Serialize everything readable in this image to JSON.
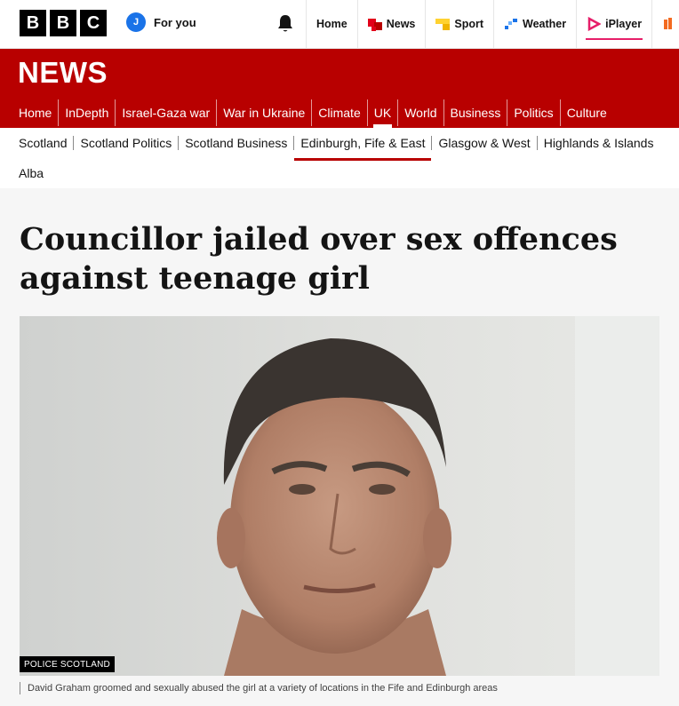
{
  "brand": {
    "logo_letters": [
      "B",
      "B",
      "C"
    ]
  },
  "account": {
    "initial": "J",
    "label": "For you"
  },
  "top_nav": [
    {
      "label": "Home",
      "icon": "none"
    },
    {
      "label": "News",
      "icon": "news-icon",
      "color": "#e2001a"
    },
    {
      "label": "Sport",
      "icon": "sport-icon",
      "color": "#ffd230"
    },
    {
      "label": "Weather",
      "icon": "weather-icon",
      "color": "#1a73e8"
    },
    {
      "label": "iPlayer",
      "icon": "iplayer-icon",
      "color": "#e61e69"
    }
  ],
  "section": {
    "title": "NEWS"
  },
  "main_nav": [
    "Home",
    "InDepth",
    "Israel-Gaza war",
    "War in Ukraine",
    "Climate",
    "UK",
    "World",
    "Business",
    "Politics",
    "Culture"
  ],
  "sub_nav_row1": [
    "Scotland",
    "Scotland Politics",
    "Scotland Business",
    "Edinburgh, Fife & East",
    "Glasgow & West",
    "Highlands & Islands"
  ],
  "sub_nav_row2": [
    "Alba"
  ],
  "article": {
    "headline": "Councillor jailed over sex offences against teenage girl",
    "image_credit": "POLICE SCOTLAND",
    "caption": "David Graham groomed and sexually abused the girl at a variety of locations in the Fife and Edinburgh areas"
  },
  "colors": {
    "brand_red": "#b80000",
    "iplayer_pink": "#e61e69"
  }
}
